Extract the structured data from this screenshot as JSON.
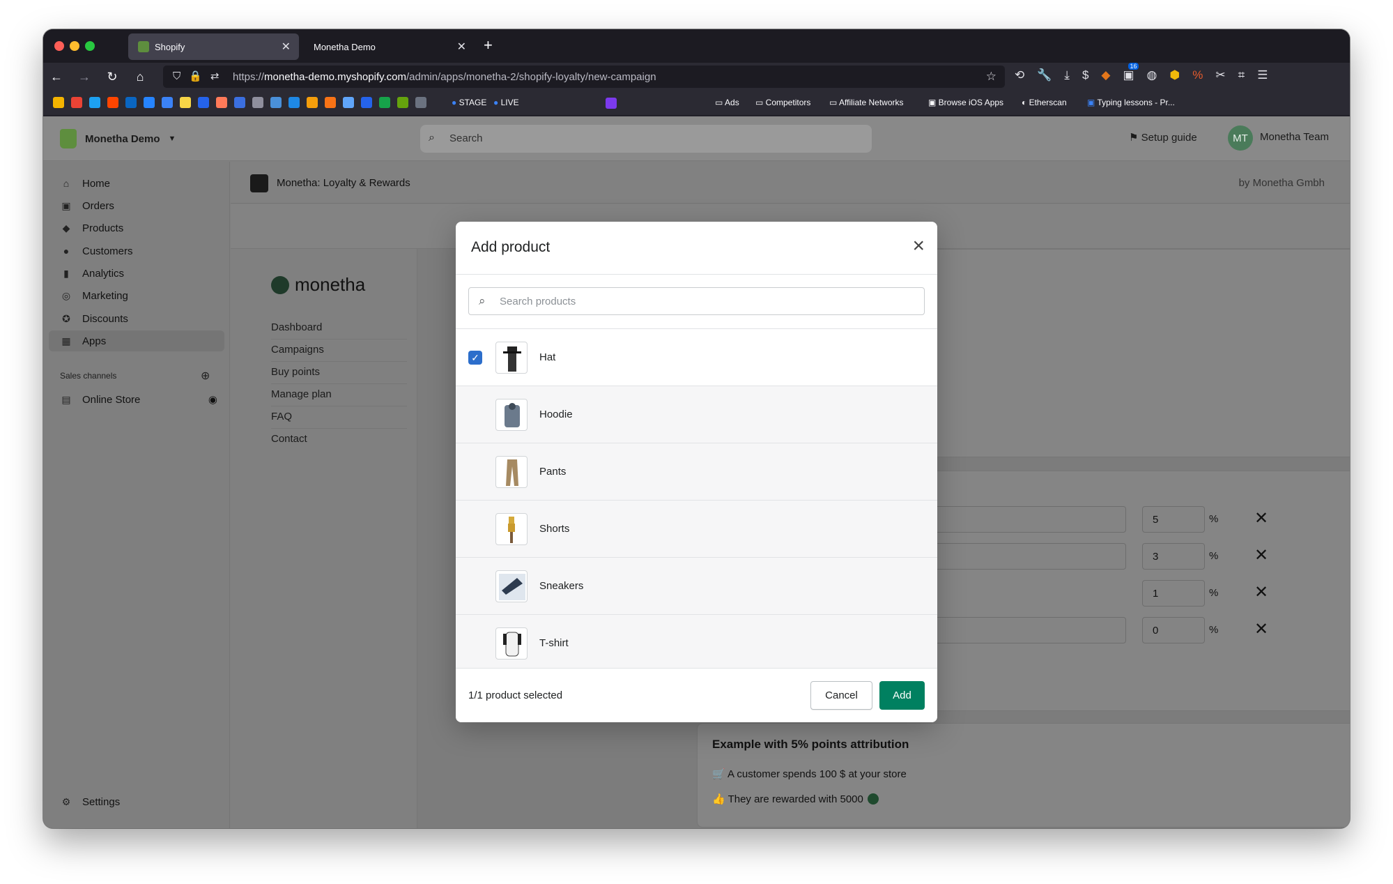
{
  "browser": {
    "tabs": [
      {
        "label": "Shopify",
        "active": true
      },
      {
        "label": "Monetha Demo",
        "active": false
      }
    ],
    "url_prefix": "https://",
    "url_host": "monetha-demo.myshopify.com",
    "url_path": "/admin/apps/monetha-2/shopify-loyalty/new-campaign",
    "bookmarks": [
      "STAGE",
      "LIVE",
      "Ads",
      "Competitors",
      "Affiliate Networks",
      "Browse iOS Apps",
      "Etherscan",
      "Typing lessons - Pr..."
    ],
    "toolbar_badge": "16"
  },
  "topbar": {
    "store_name": "Monetha Demo",
    "search_placeholder": "Search",
    "setup_guide": "Setup guide",
    "avatar_initials": "MT",
    "user_name": "Monetha Team"
  },
  "sidebar": {
    "items": [
      {
        "label": "Home",
        "icon": "home-icon"
      },
      {
        "label": "Orders",
        "icon": "orders-icon"
      },
      {
        "label": "Products",
        "icon": "tag-icon"
      },
      {
        "label": "Customers",
        "icon": "person-icon"
      },
      {
        "label": "Analytics",
        "icon": "bar-chart-icon"
      },
      {
        "label": "Marketing",
        "icon": "target-icon"
      },
      {
        "label": "Discounts",
        "icon": "discount-icon"
      },
      {
        "label": "Apps",
        "icon": "apps-icon"
      }
    ],
    "sales_channels_label": "Sales channels",
    "online_store": "Online Store",
    "settings": "Settings"
  },
  "app_header": {
    "title": "Monetha: Loyalty & Rewards",
    "by": "by Monetha Gmbh"
  },
  "app_nav": {
    "brand": "monetha",
    "items": [
      "Dashboard",
      "Campaigns",
      "Buy points",
      "Manage plan",
      "FAQ",
      "Contact"
    ]
  },
  "background_form": {
    "percent_values": [
      "5",
      "3",
      "1",
      "0"
    ],
    "percent_sign": "%",
    "example_title": "Example with 5% points attribution",
    "example_line1": "A customer spends 100 $ at your store",
    "example_line2": "They are rewarded with 5000"
  },
  "modal": {
    "title": "Add product",
    "search_placeholder": "Search products",
    "products": [
      {
        "name": "Hat",
        "selected": true
      },
      {
        "name": "Hoodie",
        "selected": false
      },
      {
        "name": "Pants",
        "selected": false
      },
      {
        "name": "Shorts",
        "selected": false
      },
      {
        "name": "Sneakers",
        "selected": false
      },
      {
        "name": "T-shirt",
        "selected": false
      }
    ],
    "selection_count": "1/1 product selected",
    "cancel_label": "Cancel",
    "add_label": "Add"
  },
  "colors": {
    "primary_button": "#008060",
    "checkbox": "#2c6ecb",
    "shopify_green": "#5e8e3e"
  }
}
